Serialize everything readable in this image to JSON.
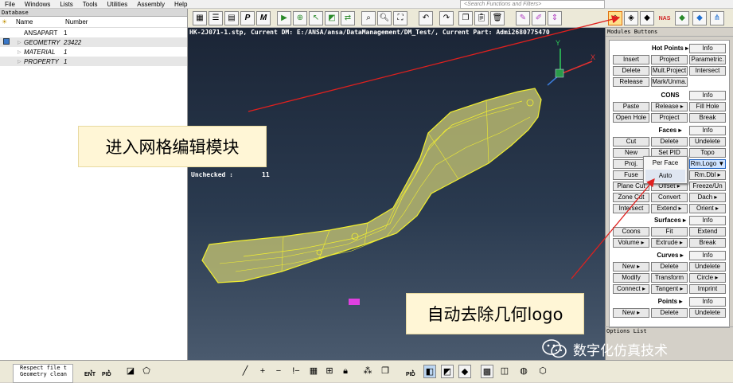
{
  "menubar": {
    "items": [
      "File",
      "Windows",
      "Lists",
      "Tools",
      "Utilities",
      "Assembly",
      "Help"
    ]
  },
  "search": {
    "placeholder": "<Search Functions and Filters>"
  },
  "database": {
    "title": "Database",
    "columns": [
      "Name",
      "Number"
    ],
    "rows": [
      {
        "name": "ANSAPART",
        "count": "1"
      },
      {
        "name": "GEOMETRY",
        "count": "23422"
      },
      {
        "name": "MATERIAL",
        "count": "1"
      },
      {
        "name": "PROPERTY",
        "count": "1"
      }
    ]
  },
  "viewport": {
    "path_line": "HK-2J071-1.stp,  Current DM: E:/ANSA/ansa/DataManagement/DM_Test/,  Current Part: Admi2680775470",
    "unchecked_label": "Unchecked :",
    "unchecked_count": "11",
    "axes": {
      "y": "Y",
      "x": "X"
    }
  },
  "annotations": {
    "caption1": "进入网格编辑模块",
    "caption2": "自动去除几何logo",
    "arrow_color": "#e0201e"
  },
  "toolbar": {
    "nas_label": "NAS",
    "pid_label": "PID"
  },
  "modules": {
    "title": "Modules Buttons",
    "options_list": "Options List",
    "sections": {
      "hotpoints": {
        "title": "Hot Points ▸",
        "info": "Info",
        "buttons": [
          "Insert",
          "Project",
          "Parametric.",
          "Delete",
          "Mult.Project",
          "Intersect",
          "Release",
          "Mark/Unma."
        ]
      },
      "cons": {
        "title": "CONS",
        "info": "Info",
        "buttons": [
          "Paste",
          "Release ▸",
          "Fill Hole",
          "Open Hole",
          "Project",
          "Break"
        ]
      },
      "faces": {
        "title": "Faces ▸",
        "info": "Info",
        "buttons": [
          "Cut",
          "Delete",
          "Undelete",
          "New",
          "Set PID",
          "Topo",
          "Proj.",
          "Rm.Logo ▼",
          "Fuse",
          "Rm.Dbl ▸",
          "Plane Cut",
          "Offset ▸",
          "Freeze/Un",
          "Zone Cut",
          "Convert",
          "Dach ▸",
          "Intersect",
          "Extend ▸",
          "Orient ▸"
        ]
      },
      "surfaces": {
        "title": "Surfaces ▸",
        "info": "Info",
        "buttons": [
          "Coons",
          "Fit",
          "Extend",
          "Volume ▸",
          "Extrude ▸",
          "Break"
        ]
      },
      "curves": {
        "title": "Curves ▸",
        "info": "Info",
        "buttons": [
          "New ▸",
          "Delete",
          "Undelete",
          "Modify",
          "Transform",
          "Circle ▸",
          "Connect ▸",
          "Tangent ▸",
          "Imprint"
        ]
      },
      "points": {
        "title": "Points ▸",
        "info": "Info",
        "buttons": [
          "New ▸",
          "Delete",
          "Undelete"
        ]
      }
    },
    "popup": [
      "Per Face",
      "Auto"
    ]
  },
  "messages": [
    "Respect file t",
    "Geometry clean"
  ],
  "bottom": {
    "ent_label": "ENT",
    "pid_label": "PID"
  },
  "watermark": "数字化仿真技术"
}
